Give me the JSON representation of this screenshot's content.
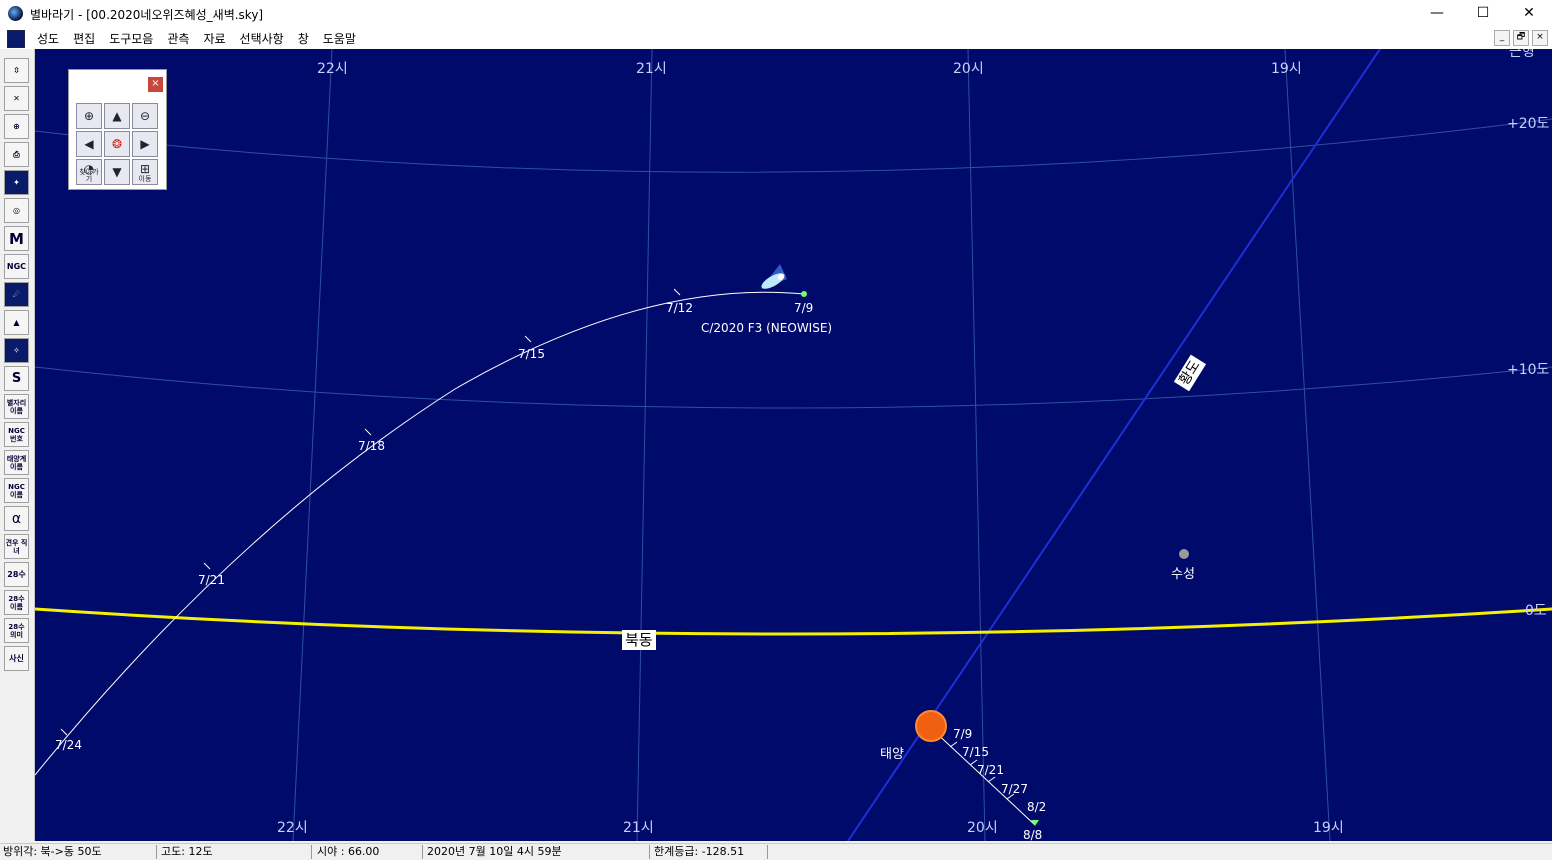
{
  "window": {
    "title": "별바라기 - [00.2020네오위즈혜성_새벽.sky]",
    "minimize": "—",
    "maximize": "☐",
    "close": "✕"
  },
  "menu": [
    "성도",
    "편집",
    "도구모음",
    "관측",
    "자료",
    "선택사항",
    "창",
    "도움말"
  ],
  "mdi_buttons": [
    "_",
    "🗗",
    "×"
  ],
  "toolbar": [
    {
      "icon": "move-icon",
      "label": "⇳"
    },
    {
      "icon": "star-cross-icon",
      "label": "✕"
    },
    {
      "icon": "globe-icon",
      "label": "⊕"
    },
    {
      "icon": "print-icon",
      "label": "⎙"
    },
    {
      "icon": "starfield-icon",
      "label": "✦"
    },
    {
      "icon": "galaxy-icon",
      "label": "◎"
    },
    {
      "icon": "messier-icon",
      "label": "M"
    },
    {
      "icon": "ngc-icon",
      "label": "NGC"
    },
    {
      "icon": "comet-icon",
      "label": "☄"
    },
    {
      "icon": "mountain-icon",
      "label": "▲"
    },
    {
      "icon": "nebula-icon",
      "label": "✧"
    },
    {
      "icon": "milkyway-icon",
      "label": "S"
    },
    {
      "icon": "constellation-name-icon",
      "label": "별자리 이름"
    },
    {
      "icon": "ngc-number-icon",
      "label": "NGC 번호"
    },
    {
      "icon": "planet-name-icon",
      "label": "태양계 이름"
    },
    {
      "icon": "ngc-name-icon",
      "label": "NGC 이름"
    },
    {
      "icon": "alpha-icon",
      "label": "α"
    },
    {
      "icon": "gyeonu-icon",
      "label": "견우 직녀"
    },
    {
      "icon": "28su-icon",
      "label": "28수"
    },
    {
      "icon": "28su-name-icon",
      "label": "28수 이름"
    },
    {
      "icon": "28su-meaning-icon",
      "label": "28수 의미"
    },
    {
      "icon": "sasin-icon",
      "label": "사신"
    }
  ],
  "nav_panel": {
    "close": "×",
    "buttons": [
      {
        "icon": "zoom-in-icon",
        "glyph": "⊕",
        "label": ""
      },
      {
        "icon": "arrow-up-icon",
        "glyph": "▲",
        "label": ""
      },
      {
        "icon": "zoom-out-icon",
        "glyph": "⊖",
        "label": ""
      },
      {
        "icon": "arrow-left-icon",
        "glyph": "◀",
        "label": ""
      },
      {
        "icon": "center-icon",
        "glyph": "❂",
        "label": ""
      },
      {
        "icon": "arrow-right-icon",
        "glyph": "▶",
        "label": ""
      },
      {
        "icon": "find-icon",
        "glyph": "◔",
        "label": "찾아가기"
      },
      {
        "icon": "arrow-down-icon",
        "glyph": "▼",
        "label": ""
      },
      {
        "icon": "move-grid-icon",
        "glyph": "⊞",
        "label": "이동"
      }
    ]
  },
  "sky": {
    "ra_labels_top": [
      "22시",
      "21시",
      "20시",
      "19시"
    ],
    "ra_labels_bottom": [
      "22시",
      "21시",
      "20시",
      "19시"
    ],
    "dec_labels": [
      "+20도",
      "+10도",
      "0도"
    ],
    "top_right_partial": "근형",
    "horizon_label": "북동",
    "ecliptic_label": "황도",
    "comet": {
      "name": "C/2020 F3 (NEOWISE)",
      "dates": [
        "7/9",
        "7/12",
        "7/15",
        "7/18",
        "7/21",
        "7/24"
      ]
    },
    "sun": {
      "name": "태양",
      "dates": [
        "7/9",
        "7/15",
        "7/21",
        "7/27",
        "8/2",
        "8/8"
      ]
    },
    "mercury": {
      "name": "수성"
    },
    "colors": {
      "background": "#000a6a",
      "grid": "#2f4fa0",
      "horizon": "#f4f000",
      "ecliptic": "#1f2fd8",
      "sun": "#f06010",
      "comet_path": "#ffffff"
    }
  },
  "status": {
    "azimuth": "방위각: 북->동 50도",
    "altitude": "고도: 12도",
    "fov": "시야 : 66.00",
    "datetime": "2020년 7월 10일 4시 59분",
    "limit_mag": "한계등급: -128.51"
  }
}
